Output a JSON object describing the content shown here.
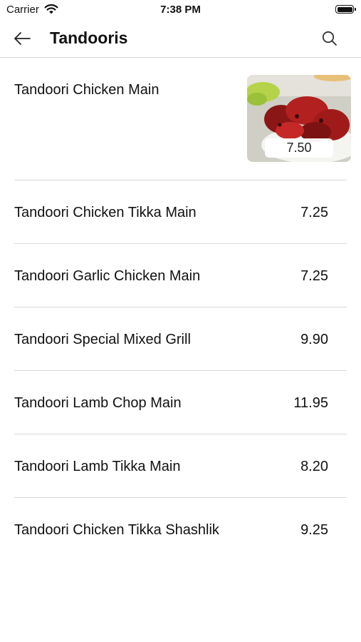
{
  "status_bar": {
    "carrier": "Carrier",
    "time": "7:38 PM"
  },
  "nav": {
    "title": "Tandooris",
    "back_icon": "back-arrow-icon",
    "search_icon": "search-icon"
  },
  "featured": {
    "name": "Tandoori Chicken Main",
    "price": "7.50"
  },
  "items": [
    {
      "name": "Tandoori Chicken Tikka Main",
      "price": "7.25"
    },
    {
      "name": "Tandoori Garlic Chicken Main",
      "price": "7.25"
    },
    {
      "name": "Tandoori Special Mixed Grill",
      "price": "9.90"
    },
    {
      "name": "Tandoori Lamb Chop Main",
      "price": "11.95"
    },
    {
      "name": "Tandoori Lamb Tikka Main",
      "price": "8.20"
    },
    {
      "name": "Tandoori Chicken Tikka Shashlik",
      "price": "9.25"
    }
  ]
}
